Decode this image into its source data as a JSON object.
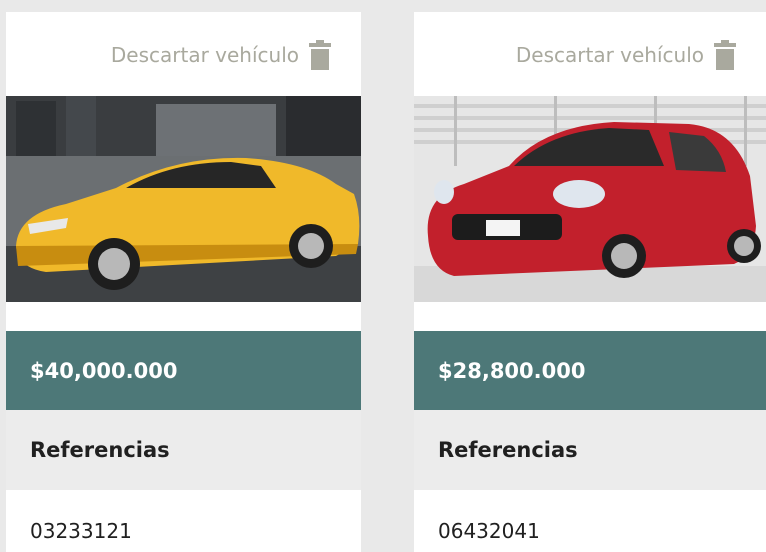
{
  "vehicles": [
    {
      "discard_label": "Descartar vehículo",
      "price": "$40,000.000",
      "references_label": "Referencias",
      "reference": "03233121",
      "color": "#f0b92a"
    },
    {
      "discard_label": "Descartar vehículo",
      "price": "$28,800.000",
      "references_label": "Referencias",
      "reference": "06432041",
      "color": "#c2202c"
    }
  ],
  "colors": {
    "price_bar": "#4d7878",
    "discard_text": "#a9a99e",
    "references_bar": "#ececec"
  }
}
